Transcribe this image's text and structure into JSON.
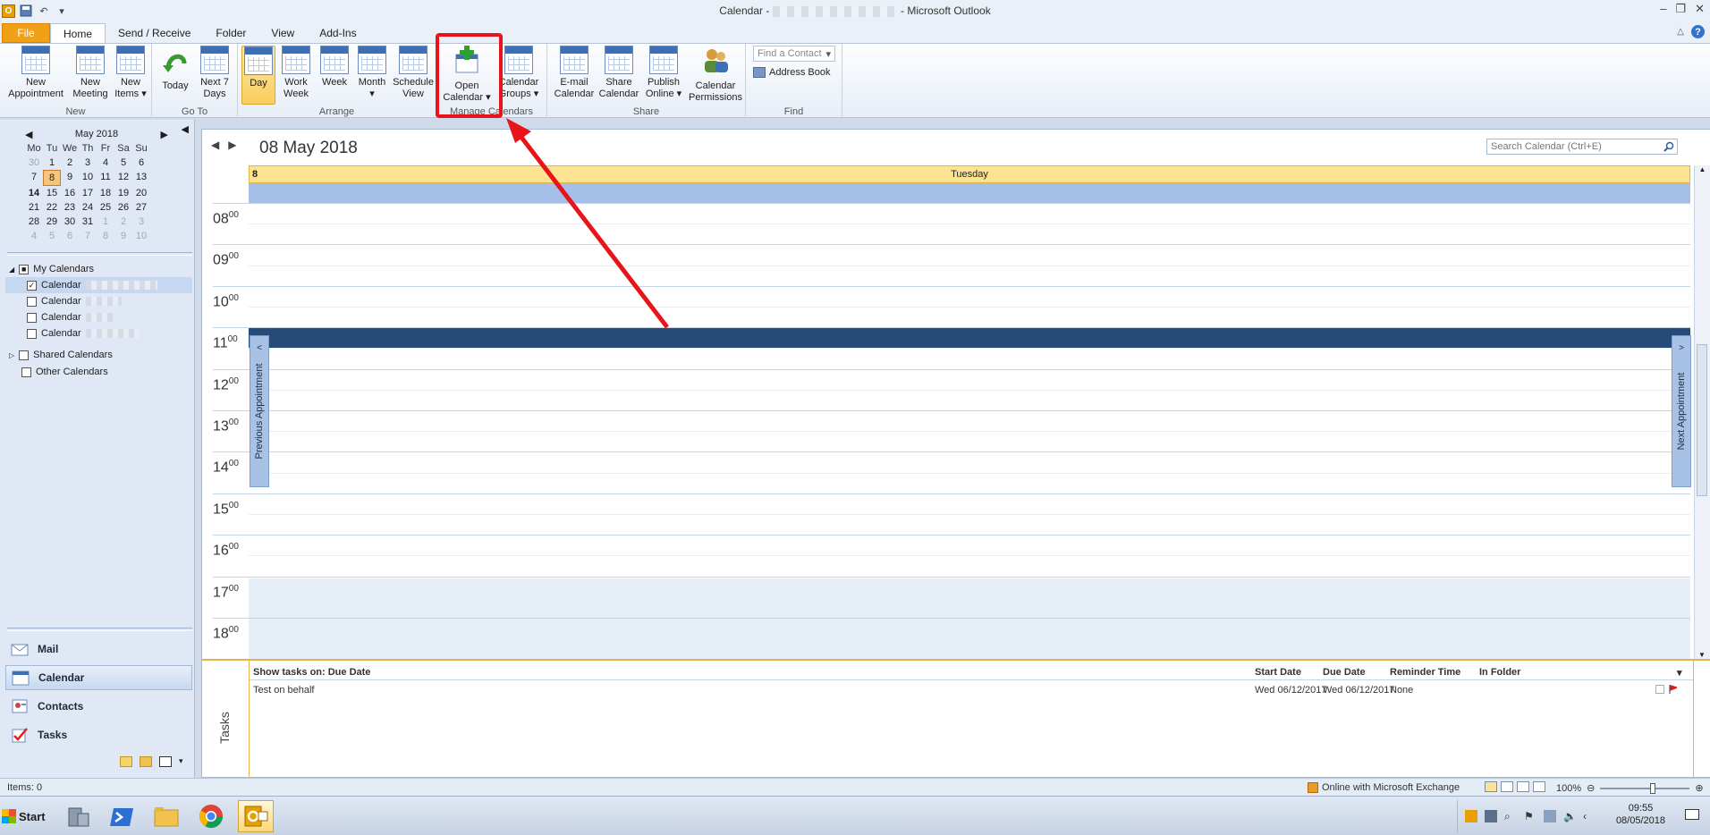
{
  "window": {
    "title_prefix": "Calendar - ",
    "title_suffix": " - Microsoft Outlook"
  },
  "tabs": [
    {
      "label": "File"
    },
    {
      "label": "Home"
    },
    {
      "label": "Send / Receive"
    },
    {
      "label": "Folder"
    },
    {
      "label": "View"
    },
    {
      "label": "Add-Ins"
    }
  ],
  "ribbon": {
    "groups": {
      "new": "New",
      "goto": "Go To",
      "arrange": "Arrange",
      "manage": "Manage Calendars",
      "share": "Share",
      "find": "Find"
    },
    "new_appointment": [
      "New",
      "Appointment"
    ],
    "new_meeting": [
      "New",
      "Meeting"
    ],
    "new_items": [
      "New",
      "Items ▾"
    ],
    "today": "Today",
    "next7": [
      "Next 7",
      "Days"
    ],
    "day": "Day",
    "work_week": [
      "Work",
      "Week"
    ],
    "week": "Week",
    "month": [
      "Month",
      "▾"
    ],
    "schedule_view": [
      "Schedule",
      "View"
    ],
    "open_calendar": [
      "Open",
      "Calendar ▾"
    ],
    "calendar_groups": [
      "Calendar",
      "Groups ▾"
    ],
    "email_calendar": [
      "E-mail",
      "Calendar"
    ],
    "share_calendar": [
      "Share",
      "Calendar"
    ],
    "publish_online": [
      "Publish",
      "Online ▾"
    ],
    "calendar_permissions": [
      "Calendar",
      "Permissions"
    ],
    "find_contact_placeholder": "Find a Contact",
    "address_book": "Address Book"
  },
  "mini_calendar": {
    "month_label": "May 2018",
    "dow": [
      "Mo",
      "Tu",
      "We",
      "Th",
      "Fr",
      "Sa",
      "Su"
    ],
    "weeks": [
      [
        "30",
        "1",
        "2",
        "3",
        "4",
        "5",
        "6"
      ],
      [
        "7",
        "8",
        "9",
        "10",
        "11",
        "12",
        "13"
      ],
      [
        "14",
        "15",
        "16",
        "17",
        "18",
        "19",
        "20"
      ],
      [
        "21",
        "22",
        "23",
        "24",
        "25",
        "26",
        "27"
      ],
      [
        "28",
        "29",
        "30",
        "31",
        "1",
        "2",
        "3"
      ],
      [
        "4",
        "5",
        "6",
        "7",
        "8",
        "9",
        "10"
      ]
    ]
  },
  "calendar_tree": {
    "my_calendars": "My Calendars",
    "items": [
      "Calendar",
      "Calendar",
      "Calendar",
      "Calendar"
    ],
    "shared_calendars": "Shared Calendars",
    "other_calendars": "Other Calendars"
  },
  "nav": {
    "mail": "Mail",
    "calendar": "Calendar",
    "contacts": "Contacts",
    "tasks": "Tasks"
  },
  "main": {
    "date_title": "08 May 2018",
    "search_placeholder": "Search Calendar (Ctrl+E)",
    "day_number": "8",
    "day_name": "Tuesday",
    "hours": [
      "08",
      "09",
      "10",
      "11",
      "12",
      "13",
      "14",
      "15",
      "16",
      "17",
      "18"
    ],
    "minutes": "00",
    "prev_appointment": "Previous Appointment",
    "next_appointment": "Next Appointment"
  },
  "tasks": {
    "side_label": "Tasks",
    "columns": {
      "show": "Show tasks on: Due Date",
      "start": "Start Date",
      "due": "Due Date",
      "reminder": "Reminder Time",
      "folder": "In Folder"
    },
    "rows": [
      {
        "subject": "Test on behalf",
        "start": "Wed 06/12/2017",
        "due": "Wed 06/12/2017",
        "reminder": "None"
      }
    ]
  },
  "status": {
    "items": "Items: 0",
    "connection": "Online with Microsoft Exchange",
    "zoom": "100%"
  },
  "taskbar": {
    "start": "Start",
    "time": "09:55",
    "date": "08/05/2018"
  },
  "colors": {
    "accent": "#f2a116",
    "appointment": "#264b78",
    "callout": "#e8141a"
  }
}
